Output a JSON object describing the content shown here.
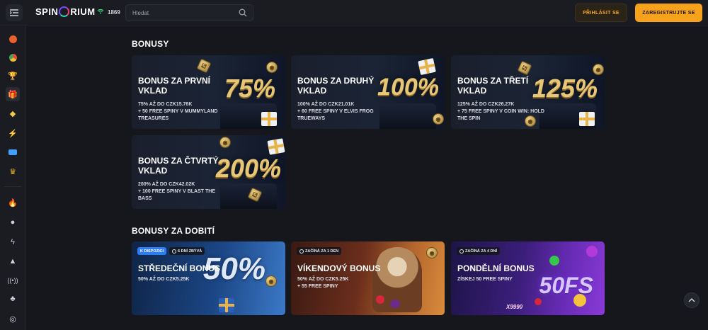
{
  "header": {
    "logo_left": "SPIN",
    "logo_right": "RIUM",
    "online_count": "1869",
    "search_placeholder": "Hledat",
    "login_label": "PŘIHLÁSIT SE",
    "register_label": "ZAREGISTRUJTE SE"
  },
  "sidebar": {
    "icons": [
      "basketball-icon",
      "chrome-icon",
      "trophy-icon",
      "gift-icon",
      "diamond-icon",
      "lightning-icon",
      "card-icon",
      "crown-icon",
      "fire-icon",
      "chat-icon",
      "bolt-icon",
      "triangle-icon",
      "broadcast-icon",
      "cherries-icon",
      "globe-icon"
    ]
  },
  "sections": {
    "bonuses_title": "BONUSY",
    "reload_title": "BONUSY ZA DOBITÍ"
  },
  "bonus_cards": [
    {
      "title": "BONUS ZA PRVNÍ VKLAD",
      "line1": "75% AŽ DO CZK15.76K",
      "line2": "+ 50 FREE SPINY V MUMMYLAND TREASURES",
      "big": "75%"
    },
    {
      "title": "BONUS ZA DRUHÝ VKLAD",
      "line1": "100% AŽ DO CZK21.01K",
      "line2": "+ 60 FREE SPINY V ELVIS FROG TRUEWAYS",
      "big": "100%"
    },
    {
      "title": "BONUS ZA TŘETÍ VKLAD",
      "line1": "125% AŽ DO CZK26.27K",
      "line2": "+ 75 FREE SPINY V COIN WIN: HOLD THE SPIN",
      "big": "125%"
    },
    {
      "title": "BONUS ZA ČTVRTÝ VKLAD",
      "line1": "200% AŽ DO CZK42.02K",
      "line2": "+ 100 FREE SPINY V BLAST THE BASS",
      "big": "200%"
    }
  ],
  "reload_cards": [
    {
      "badge1": "K DISPOZICI",
      "badge2": "6 DNÍ ZBÝVÁ",
      "title": "STŘEDEČNÍ BONUS",
      "line1": "50% AŽ DO CZK5.25K",
      "line2": "",
      "art": "50%"
    },
    {
      "badge1": "",
      "badge2": "ZAČÍNÁ ZA 1 DEN",
      "title": "VÍKENDOVÝ BONUS",
      "line1": "50% AŽ DO CZK5.25K",
      "line2": "+ 55 FREE SPINY",
      "art": ""
    },
    {
      "badge1": "",
      "badge2": "ZAČÍNÁ ZA 4 DNÍ",
      "title": "PONDĚLNÍ BONUS",
      "line1": "ZÍSKEJ 50 FREE SPINY",
      "line2": "",
      "art": "50FS",
      "art2": "X9990"
    }
  ]
}
